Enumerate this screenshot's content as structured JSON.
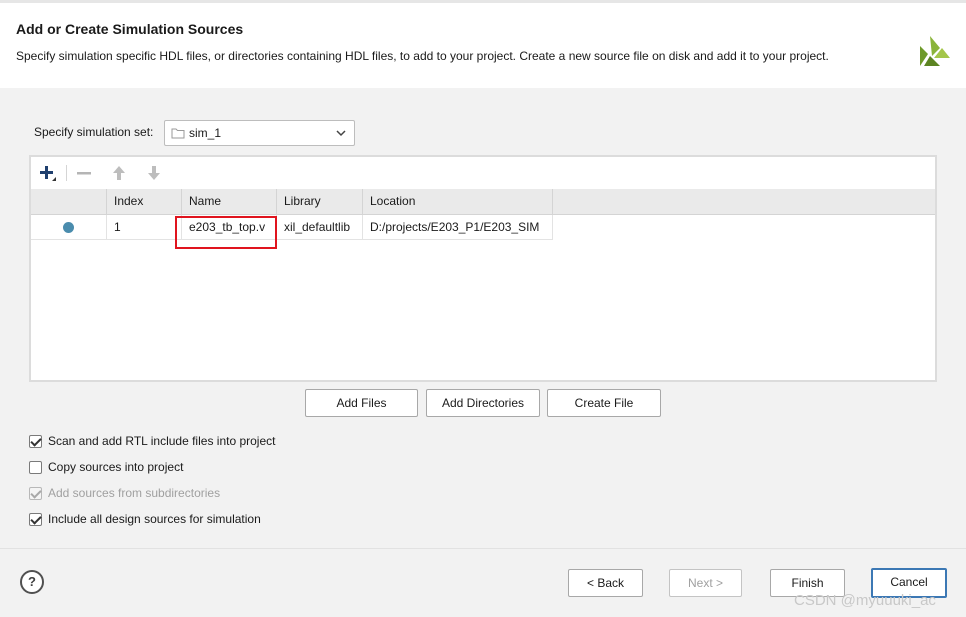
{
  "header": {
    "title": "Add or Create Simulation Sources",
    "subtitle": "Specify simulation specific HDL files, or directories containing HDL files, to add to your project. Create a new source file on disk and add it to your project.",
    "logo_icon": "vivado-logo-icon"
  },
  "simulation_set": {
    "label": "Specify simulation set:",
    "value": "sim_1"
  },
  "toolbar": {
    "add_icon": "plus-icon",
    "remove_icon": "minus-icon",
    "up_icon": "arrow-up-icon",
    "down_icon": "arrow-down-icon"
  },
  "table": {
    "columns": [
      "Index",
      "Name",
      "Library",
      "Location"
    ],
    "rows": [
      {
        "index": "1",
        "name": "e203_tb_top.v",
        "library": "xil_defaultlib",
        "location": "D:/projects/E203_P1/E203_SIM"
      }
    ]
  },
  "actions": {
    "add_files": "Add Files",
    "add_directories": "Add Directories",
    "create_file": "Create File"
  },
  "options": [
    {
      "label": "Scan and add RTL include files into project",
      "checked": true,
      "disabled": false
    },
    {
      "label": "Copy sources into project",
      "checked": false,
      "disabled": false
    },
    {
      "label": "Add sources from subdirectories",
      "checked": true,
      "disabled": true
    },
    {
      "label": "Include all design sources for simulation",
      "checked": true,
      "disabled": false
    }
  ],
  "footer": {
    "help": "?",
    "back": "< Back",
    "next": "Next >",
    "finish": "Finish",
    "cancel": "Cancel"
  },
  "watermark": "CSDN @myuuuki_ac",
  "colors": {
    "accent": "#3c78b4",
    "highlight": "#e0141e",
    "status_dot": "#4a8cad",
    "logo": "#6e9a2a"
  }
}
